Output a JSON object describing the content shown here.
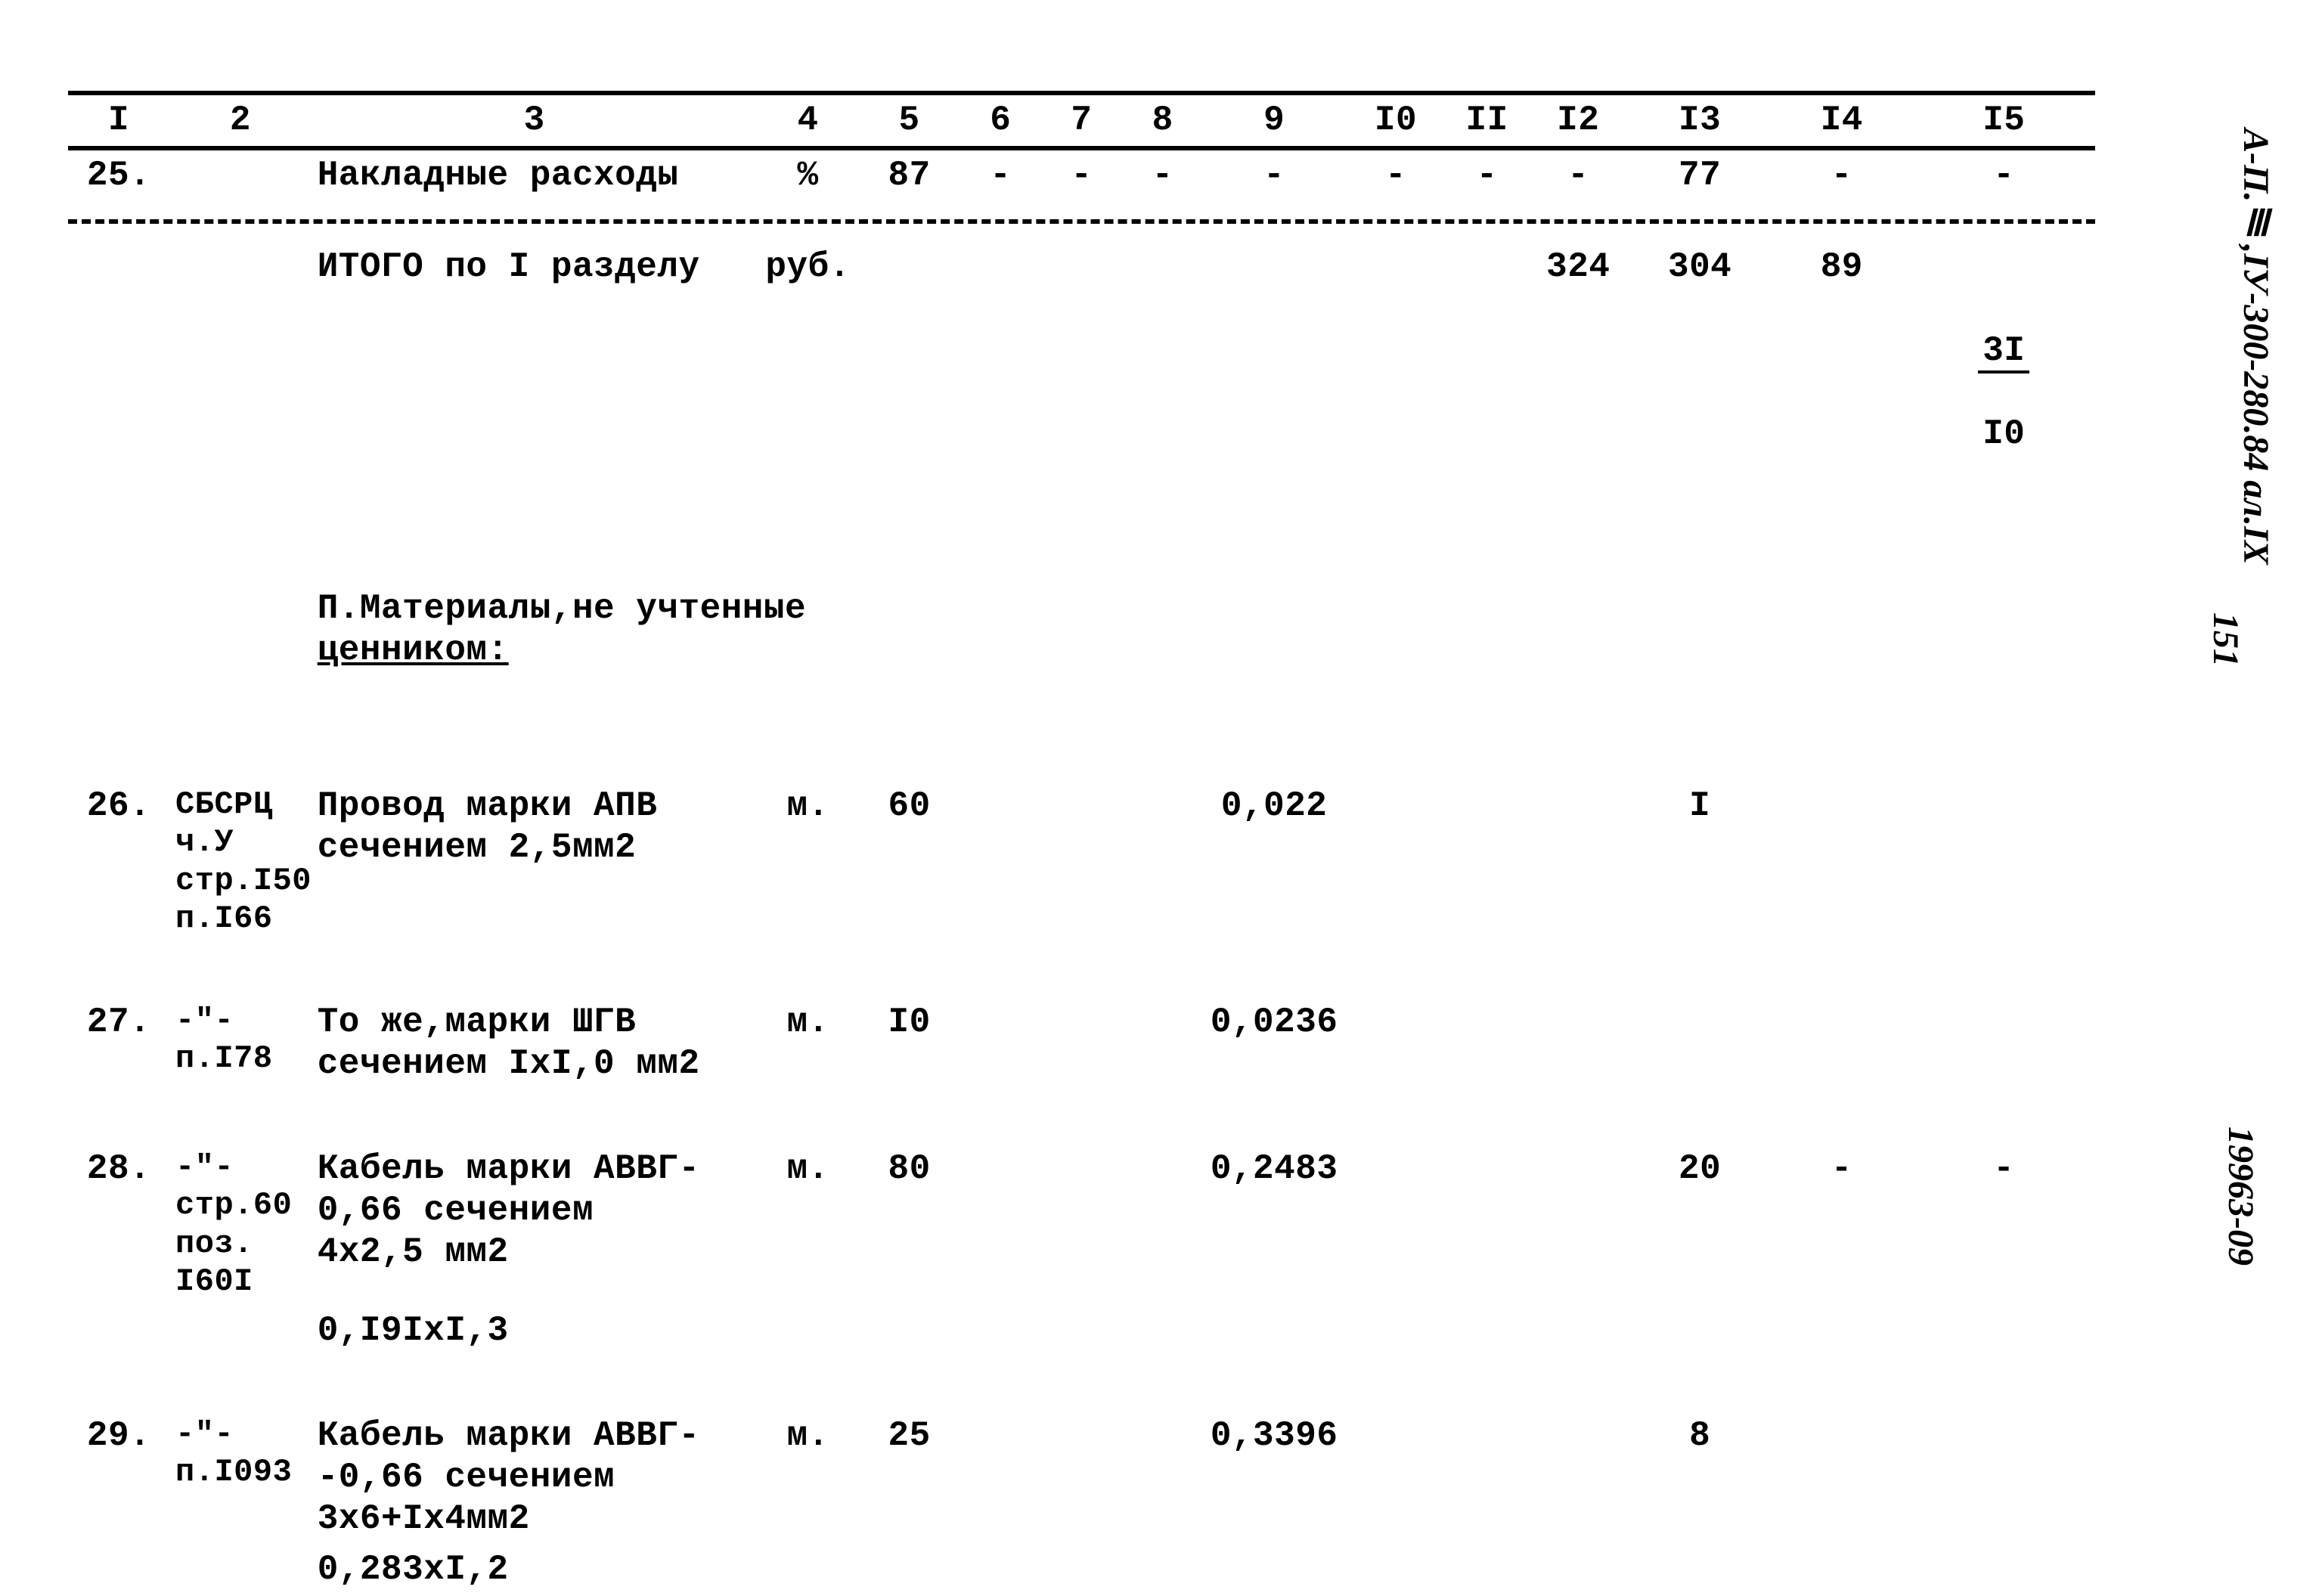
{
  "margin": {
    "doc_ref": "А-П.Ⅲ,IУ-300-280.84\nал.IX",
    "page_num": "151",
    "serial": "19963-09"
  },
  "header": {
    "c1": "I",
    "c2": "2",
    "c3": "3",
    "c4": "4",
    "c5": "5",
    "c6": "6",
    "c7": "7",
    "c8": "8",
    "c9": "9",
    "c10": "I0",
    "c11": "II",
    "c12": "I2",
    "c13": "I3",
    "c14": "I4",
    "c15": "I5"
  },
  "rows": {
    "r25": {
      "num": "25.",
      "desc": "Накладные расходы",
      "c4": "%",
      "c5": "87",
      "c6": "-",
      "c7": "-",
      "c8": "-",
      "c9": "-",
      "c10": "-",
      "c11": "-",
      "c12": "-",
      "c13": "77",
      "c14": "-",
      "c15": "-"
    },
    "itogo": {
      "desc": "ИТОГО  по I разделу",
      "c4": "руб.",
      "c12": "324",
      "c13": "304",
      "c14": "89",
      "c15_top": "3I",
      "c15_bot": "I0"
    },
    "section2_title": "П.Материалы,не учтенные",
    "section2_title_u": "ценником:",
    "r26": {
      "num": "26.",
      "ref": "СБСРЦ\nч.У\nстр.I50\nп.I66",
      "desc": "Провод марки АПВ\nсечением 2,5мм2",
      "c4": "м.",
      "c5": "60",
      "c9": "0,022",
      "c13": "I"
    },
    "r27": {
      "num": "27.",
      "ref": "-\"-\nп.I78",
      "desc": "То же,марки ШГВ\nсечением IxI,0  мм2",
      "c4": "м.",
      "c5": "I0",
      "c9": "0,0236"
    },
    "r28": {
      "num": "28.",
      "ref": "-\"-\nстр.60\nпоз.\nI60I",
      "desc": "Кабель марки АВВГ-\n0,66 сечением\n4x2,5 мм2",
      "extra": "0,I9IxI,3",
      "c4": "м.",
      "c5": "80",
      "c9": "0,2483",
      "c13": "20",
      "c14": "-",
      "c15": "-"
    },
    "r29": {
      "num": "29.",
      "ref": "-\"-\nп.I093",
      "desc": "Кабель марки АВВГ-\n-0,66 сечением\n3x6+Ix4мм2",
      "extra": "0,283xI,2",
      "c4": "м.",
      "c5": "25",
      "c9": "0,3396",
      "c13": "8"
    }
  }
}
